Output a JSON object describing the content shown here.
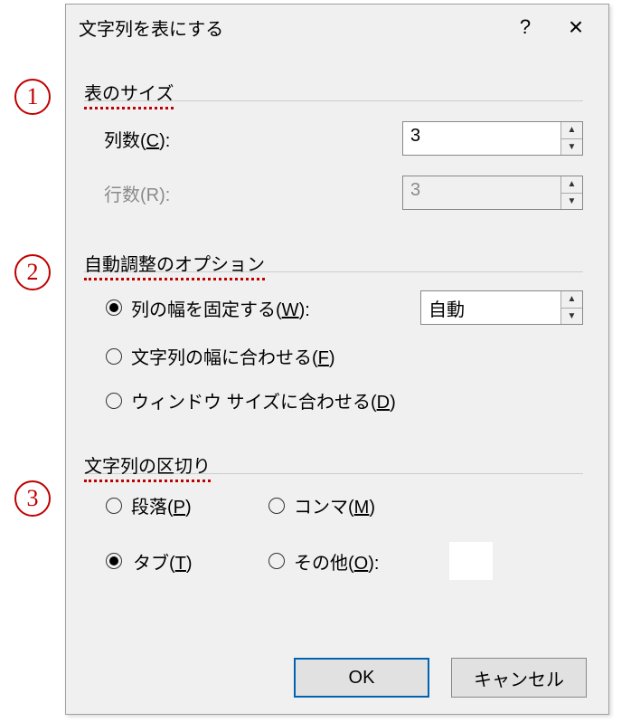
{
  "annotations": {
    "one": "1",
    "two": "2",
    "three": "3"
  },
  "dialog": {
    "title": "文字列を表にする",
    "help": "?",
    "close": "×"
  },
  "section1": {
    "title": "表のサイズ",
    "cols_label_pre": "列数(",
    "cols_hotkey": "C",
    "cols_label_post": "):",
    "cols_value": "3",
    "rows_label": "行数(R):",
    "rows_value": "3"
  },
  "section2": {
    "title": "自動調整のオプション",
    "opt_fixed_pre": "列の幅を固定する(",
    "opt_fixed_hot": "W",
    "opt_fixed_post": "):",
    "fixed_value": "自動",
    "opt_fit_pre": "文字列の幅に合わせる(",
    "opt_fit_hot": "F",
    "opt_fit_post": ")",
    "opt_win_pre": "ウィンドウ サイズに合わせる(",
    "opt_win_hot": "D",
    "opt_win_post": ")"
  },
  "section3": {
    "title": "文字列の区切り",
    "para_pre": "段落(",
    "para_hot": "P",
    "para_post": ")",
    "comma_pre": "コンマ(",
    "comma_hot": "M",
    "comma_post": ")",
    "tab_pre": "タブ(",
    "tab_hot": "T",
    "tab_post": ")",
    "other_pre": "その他(",
    "other_hot": "O",
    "other_post": "):"
  },
  "footer": {
    "ok": "OK",
    "cancel": "キャンセル"
  }
}
